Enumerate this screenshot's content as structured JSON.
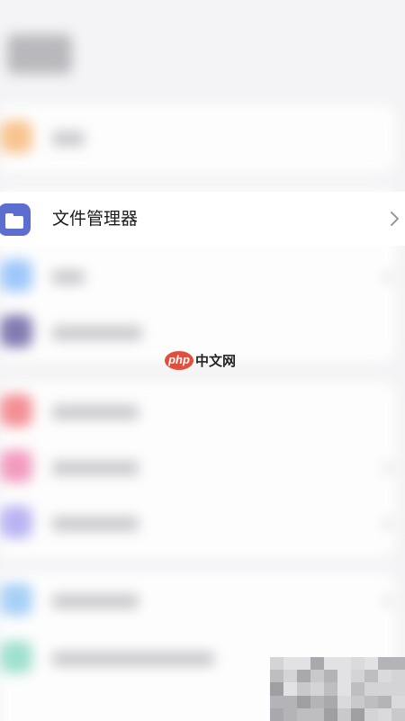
{
  "screen": {
    "title_blurred": "设置",
    "blurred_rows": [
      {
        "icon": "orange-blurred-icon",
        "color": "#f9c48f"
      },
      {
        "icon": "lightblue-blurred-icon",
        "color": "#9fc8fa"
      },
      {
        "icon": "purple-blurred-icon",
        "color": "#7f7bb0"
      },
      {
        "icon": "red-blurred-icon",
        "color": "#f38f95"
      },
      {
        "icon": "pink-blurred-icon",
        "color": "#f29bbf"
      },
      {
        "icon": "violet-blurred-icon",
        "color": "#b9b4f2"
      },
      {
        "icon": "blue-blurred-icon",
        "color": "#a7d0f7"
      },
      {
        "icon": "teal-blurred-icon",
        "color": "#9fe0cf"
      }
    ]
  },
  "focus_item": {
    "label": "文件管理器",
    "icon": "folder-icon",
    "icon_color": "#5c6fd0"
  },
  "watermark": {
    "brand_php": "php",
    "brand_cn": "中文网",
    "color": "#e34d3b"
  }
}
